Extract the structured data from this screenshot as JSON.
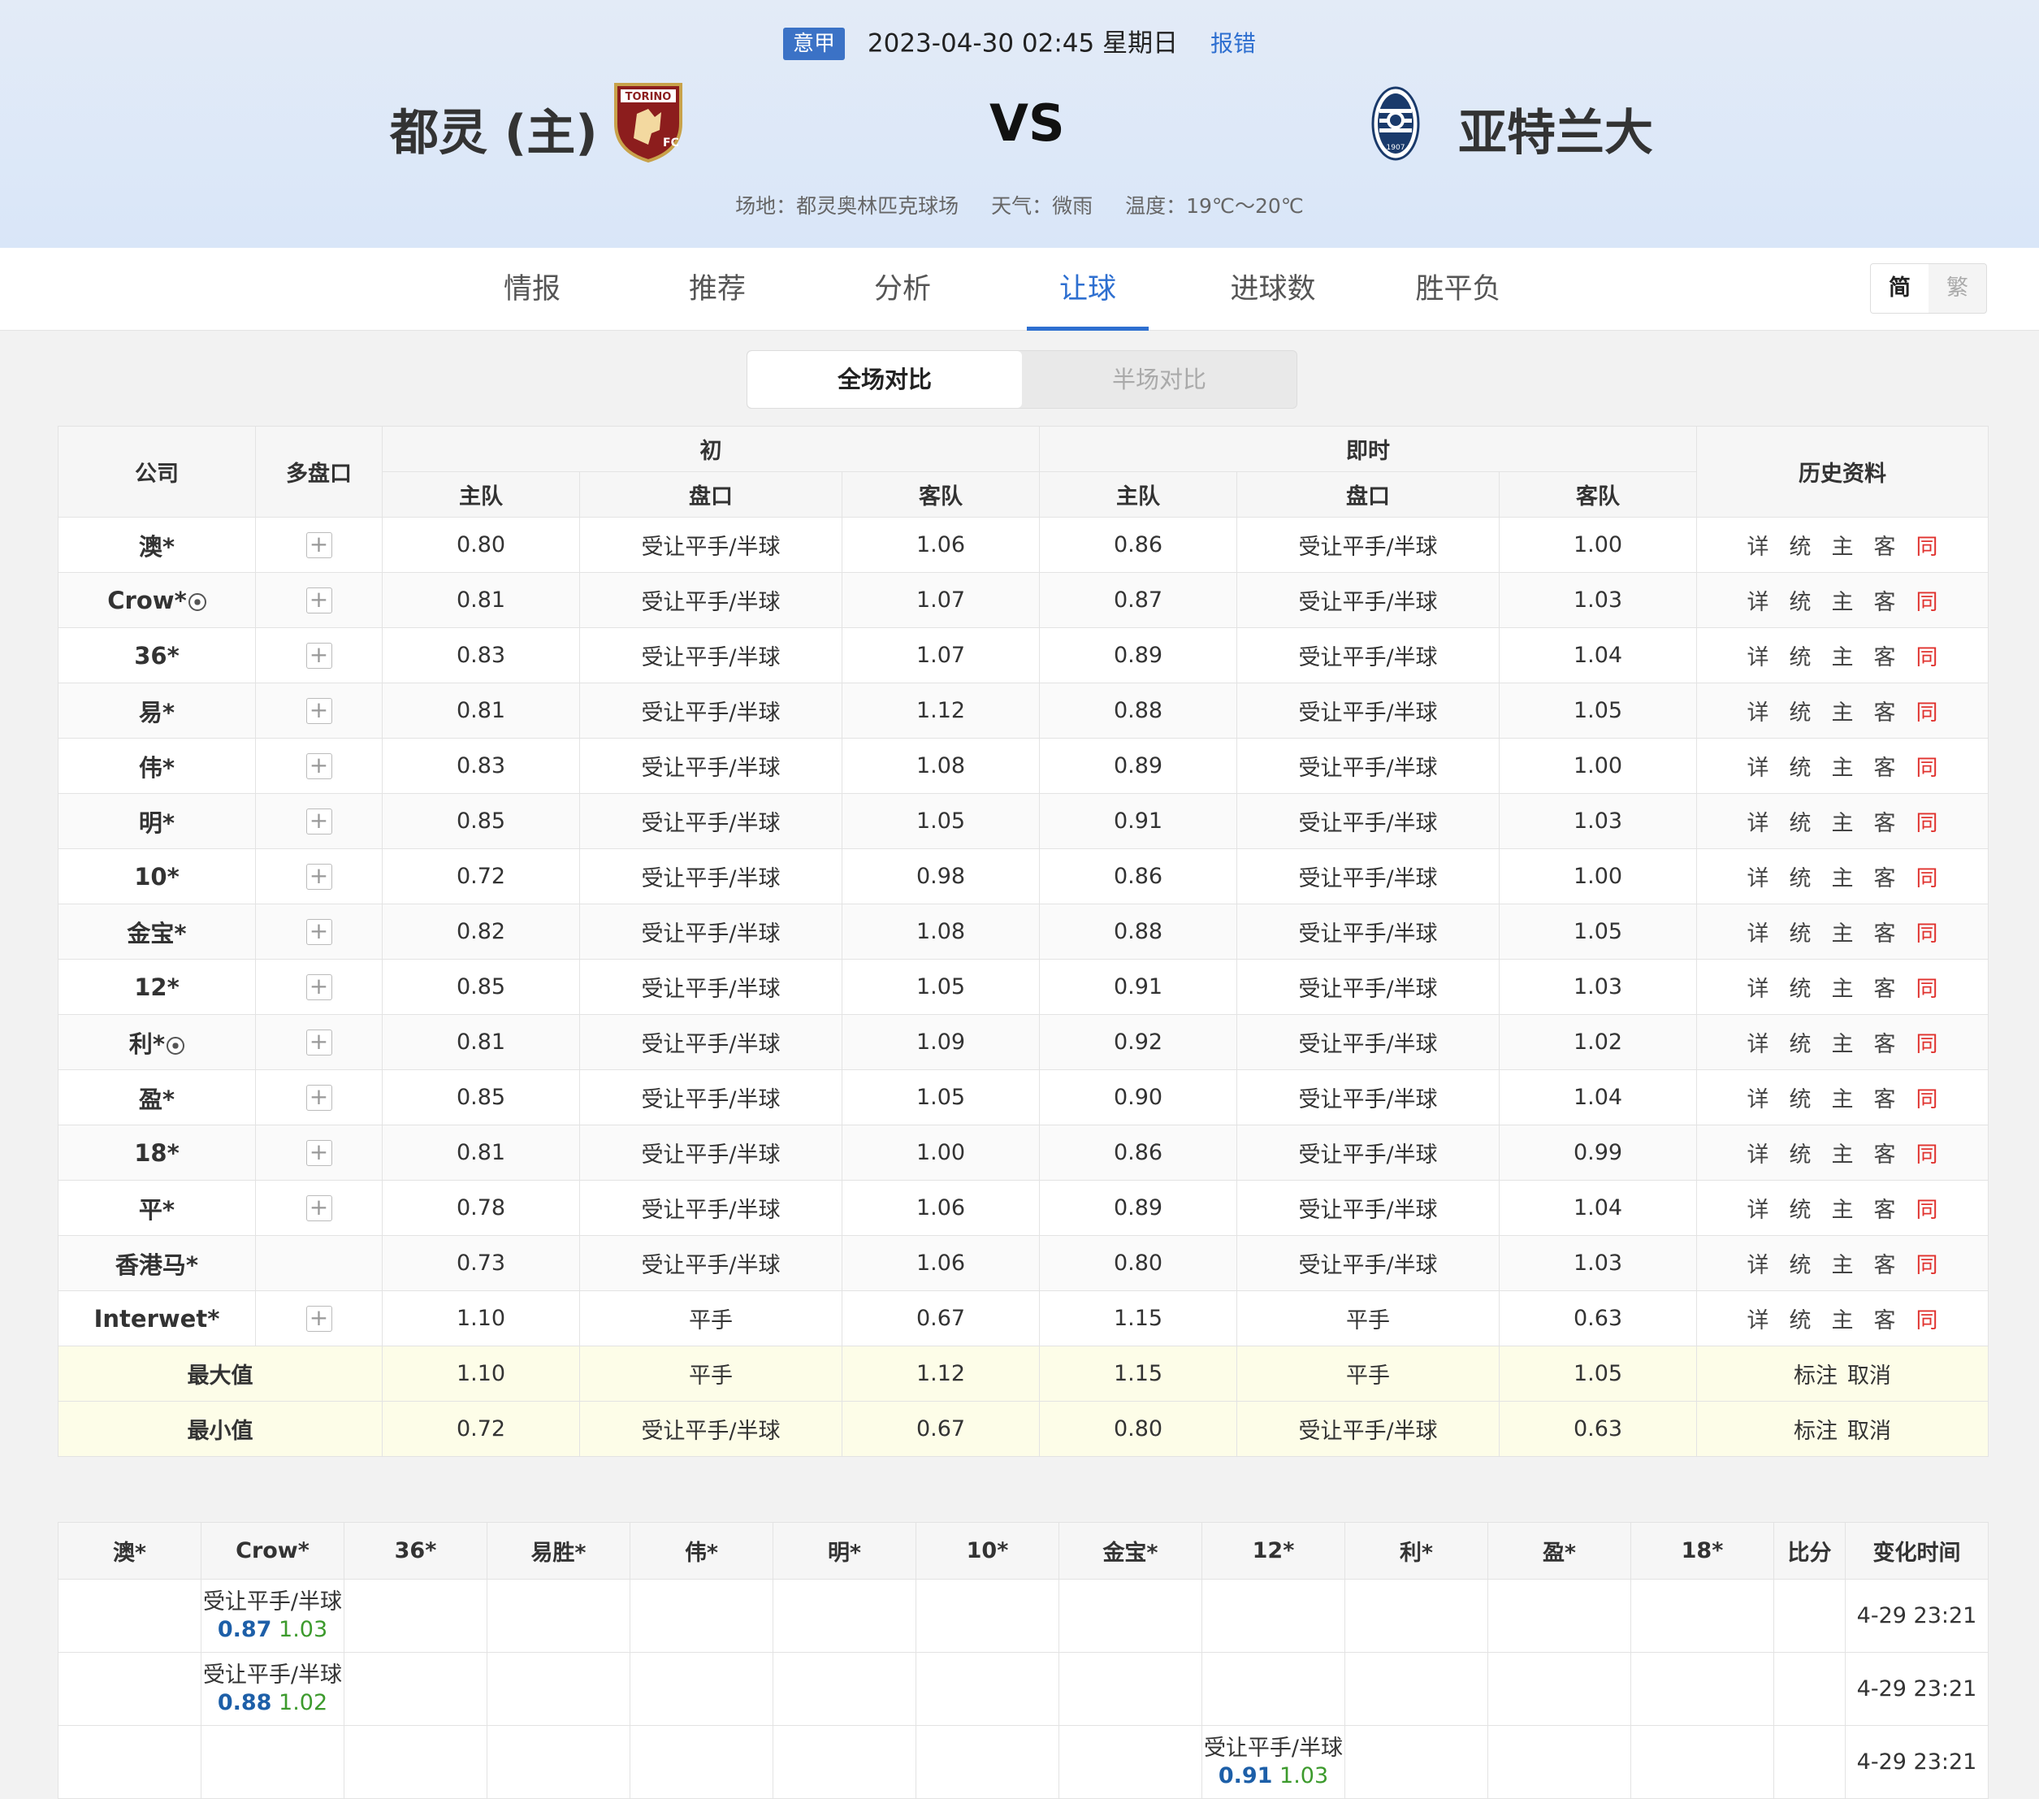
{
  "match": {
    "league": "意甲",
    "datetime": "2023-04-30 02:45 星期日",
    "report_label": "报错",
    "home_name": "都灵 (主)",
    "away_name": "亚特兰大",
    "vs": "VS",
    "venue": "场地：都灵奥林匹克球场",
    "weather": "天气：微雨",
    "temperature": "温度：19℃～20℃"
  },
  "tabs": [
    {
      "label": "情报"
    },
    {
      "label": "推荐"
    },
    {
      "label": "分析"
    },
    {
      "label": "让球",
      "active": true
    },
    {
      "label": "进球数"
    },
    {
      "label": "胜平负"
    }
  ],
  "lang": {
    "simplified": "简",
    "traditional": "繁"
  },
  "segment": {
    "full": "全场对比",
    "half": "半场对比"
  },
  "odds_table": {
    "headers": {
      "company": "公司",
      "multi": "多盘口",
      "initial": "初",
      "live": "即时",
      "history": "历史资料",
      "home": "主队",
      "line": "盘口",
      "away": "客队"
    },
    "link_labels": [
      "详",
      "统",
      "主",
      "客",
      "同"
    ],
    "rows": [
      {
        "company": "澳*",
        "ball": false,
        "plus": true,
        "i_home": "0.80",
        "i_line": "受让平手/半球",
        "i_away": "1.06",
        "l_home": "0.86",
        "l_line": "受让平手/半球",
        "l_away": "1.00"
      },
      {
        "company": "Crow*",
        "ball": true,
        "plus": true,
        "i_home": "0.81",
        "i_line": "受让平手/半球",
        "i_away": "1.07",
        "l_home": "0.87",
        "l_line": "受让平手/半球",
        "l_away": "1.03"
      },
      {
        "company": "36*",
        "ball": false,
        "plus": true,
        "i_home": "0.83",
        "i_line": "受让平手/半球",
        "i_away": "1.07",
        "l_home": "0.89",
        "l_line": "受让平手/半球",
        "l_away": "1.04"
      },
      {
        "company": "易*",
        "ball": false,
        "plus": true,
        "i_home": "0.81",
        "i_line": "受让平手/半球",
        "i_away": "1.12",
        "l_home": "0.88",
        "l_line": "受让平手/半球",
        "l_away": "1.05"
      },
      {
        "company": "伟*",
        "ball": false,
        "plus": true,
        "i_home": "0.83",
        "i_line": "受让平手/半球",
        "i_away": "1.08",
        "l_home": "0.89",
        "l_line": "受让平手/半球",
        "l_away": "1.00"
      },
      {
        "company": "明*",
        "ball": false,
        "plus": true,
        "i_home": "0.85",
        "i_line": "受让平手/半球",
        "i_away": "1.05",
        "l_home": "0.91",
        "l_line": "受让平手/半球",
        "l_away": "1.03"
      },
      {
        "company": "10*",
        "ball": false,
        "plus": true,
        "i_home": "0.72",
        "i_line": "受让平手/半球",
        "i_away": "0.98",
        "l_home": "0.86",
        "l_line": "受让平手/半球",
        "l_away": "1.00"
      },
      {
        "company": "金宝*",
        "ball": false,
        "plus": true,
        "i_home": "0.82",
        "i_line": "受让平手/半球",
        "i_away": "1.08",
        "l_home": "0.88",
        "l_line": "受让平手/半球",
        "l_away": "1.05"
      },
      {
        "company": "12*",
        "ball": false,
        "plus": true,
        "i_home": "0.85",
        "i_line": "受让平手/半球",
        "i_away": "1.05",
        "l_home": "0.91",
        "l_line": "受让平手/半球",
        "l_away": "1.03"
      },
      {
        "company": "利*",
        "ball": true,
        "plus": true,
        "i_home": "0.81",
        "i_line": "受让平手/半球",
        "i_away": "1.09",
        "l_home": "0.92",
        "l_line": "受让平手/半球",
        "l_away": "1.02"
      },
      {
        "company": "盈*",
        "ball": false,
        "plus": true,
        "i_home": "0.85",
        "i_line": "受让平手/半球",
        "i_away": "1.05",
        "l_home": "0.90",
        "l_line": "受让平手/半球",
        "l_away": "1.04"
      },
      {
        "company": "18*",
        "ball": false,
        "plus": true,
        "i_home": "0.81",
        "i_line": "受让平手/半球",
        "i_away": "1.00",
        "l_home": "0.86",
        "l_line": "受让平手/半球",
        "l_away": "0.99"
      },
      {
        "company": "平*",
        "ball": false,
        "plus": true,
        "i_home": "0.78",
        "i_line": "受让平手/半球",
        "i_away": "1.06",
        "l_home": "0.89",
        "l_line": "受让平手/半球",
        "l_away": "1.04"
      },
      {
        "company": "香港马*",
        "ball": false,
        "plus": false,
        "i_home": "0.73",
        "i_line": "受让平手/半球",
        "i_away": "1.06",
        "l_home": "0.80",
        "l_line": "受让平手/半球",
        "l_away": "1.03"
      },
      {
        "company": "Interwet*",
        "ball": false,
        "plus": true,
        "i_home": "1.10",
        "i_line": "平手",
        "i_away": "0.67",
        "l_home": "1.15",
        "l_line": "平手",
        "l_away": "0.63"
      }
    ],
    "summary": [
      {
        "label": "最大值",
        "i_home": "1.10",
        "i_line": "平手",
        "i_away": "1.12",
        "l_home": "1.15",
        "l_line": "平手",
        "l_away": "1.05",
        "mark": "标注",
        "cancel": "取消"
      },
      {
        "label": "最小值",
        "i_home": "0.72",
        "i_line": "受让平手/半球",
        "i_away": "0.67",
        "l_home": "0.80",
        "l_line": "受让平手/半球",
        "l_away": "0.63",
        "mark": "标注",
        "cancel": "取消"
      }
    ]
  },
  "change_table": {
    "headers": [
      "澳*",
      "Crow*",
      "36*",
      "易胜*",
      "伟*",
      "明*",
      "10*",
      "金宝*",
      "12*",
      "利*",
      "盈*",
      "18*",
      "比分",
      "变化时间"
    ],
    "rows": [
      {
        "col": 1,
        "line": "受让平手/半球",
        "home": "0.87",
        "away": "1.03",
        "time": "4-29 23:21"
      },
      {
        "col": 1,
        "line": "受让平手/半球",
        "home": "0.88",
        "away": "1.02",
        "time": "4-29 23:21"
      },
      {
        "col": 8,
        "line": "受让平手/半球",
        "home": "0.91",
        "away": "1.03",
        "time": "4-29 23:21"
      }
    ]
  },
  "colors": {
    "accent": "#2e6fd0",
    "league_badge": "#3b72c6",
    "tong_red": "#e0322e",
    "summary_bg": "#fdfde8",
    "home_odd_blue": "#1d5fa8",
    "away_odd_green": "#3c9a2c"
  }
}
